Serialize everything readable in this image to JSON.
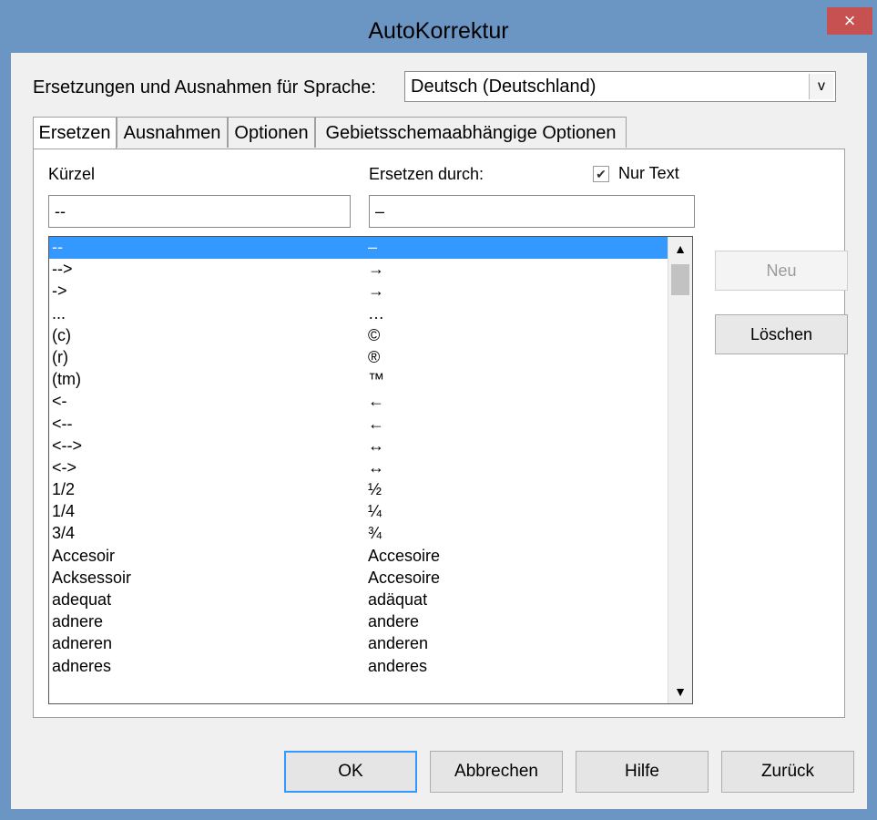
{
  "window": {
    "title": "AutoKorrektur",
    "close_label": "×"
  },
  "language": {
    "label": "Ersetzungen und Ausnahmen für Sprache:",
    "selected": "Deutsch (Deutschland)",
    "dropdown_glyph": "v"
  },
  "tabs": [
    {
      "label": "Ersetzen"
    },
    {
      "label": "Ausnahmen"
    },
    {
      "label": "Optionen"
    },
    {
      "label": "Gebietsschemaabhängige Optionen"
    }
  ],
  "replace": {
    "shortcut_label": "Kürzel",
    "replace_label": "Ersetzen durch:",
    "text_only_label": "Nur Text",
    "text_only_checked": true,
    "shortcut_value": "--",
    "replace_value": "–",
    "new_button": "Neu",
    "delete_button": "Löschen"
  },
  "list": {
    "rows": [
      {
        "short": "--",
        "repl": "–"
      },
      {
        "short": "-->",
        "repl": "→"
      },
      {
        "short": "->",
        "repl": "→"
      },
      {
        "short": "...",
        "repl": "…"
      },
      {
        "short": "(c)",
        "repl": "©"
      },
      {
        "short": "(r)",
        "repl": "®"
      },
      {
        "short": "(tm)",
        "repl": "™"
      },
      {
        "short": "<-",
        "repl": "←"
      },
      {
        "short": "<--",
        "repl": "←"
      },
      {
        "short": "<-->",
        "repl": "↔"
      },
      {
        "short": "<->",
        "repl": "↔"
      },
      {
        "short": "1/2",
        "repl": "½"
      },
      {
        "short": "1/4",
        "repl": "¼"
      },
      {
        "short": "3/4",
        "repl": "¾"
      },
      {
        "short": "Accesoir",
        "repl": "Accesoire"
      },
      {
        "short": "Acksessoir",
        "repl": "Accesoire"
      },
      {
        "short": "adequat",
        "repl": "adäquat"
      },
      {
        "short": "adnere",
        "repl": "andere"
      },
      {
        "short": "adneren",
        "repl": "anderen"
      },
      {
        "short": "adneres",
        "repl": "anderes"
      }
    ],
    "selected_index": 0
  },
  "buttons": {
    "ok": "OK",
    "cancel": "Abbrechen",
    "help": "Hilfe",
    "reset": "Zurück"
  },
  "colors": {
    "titlebar": "#6b96c4",
    "close": "#c75050",
    "selection": "#3399ff"
  }
}
